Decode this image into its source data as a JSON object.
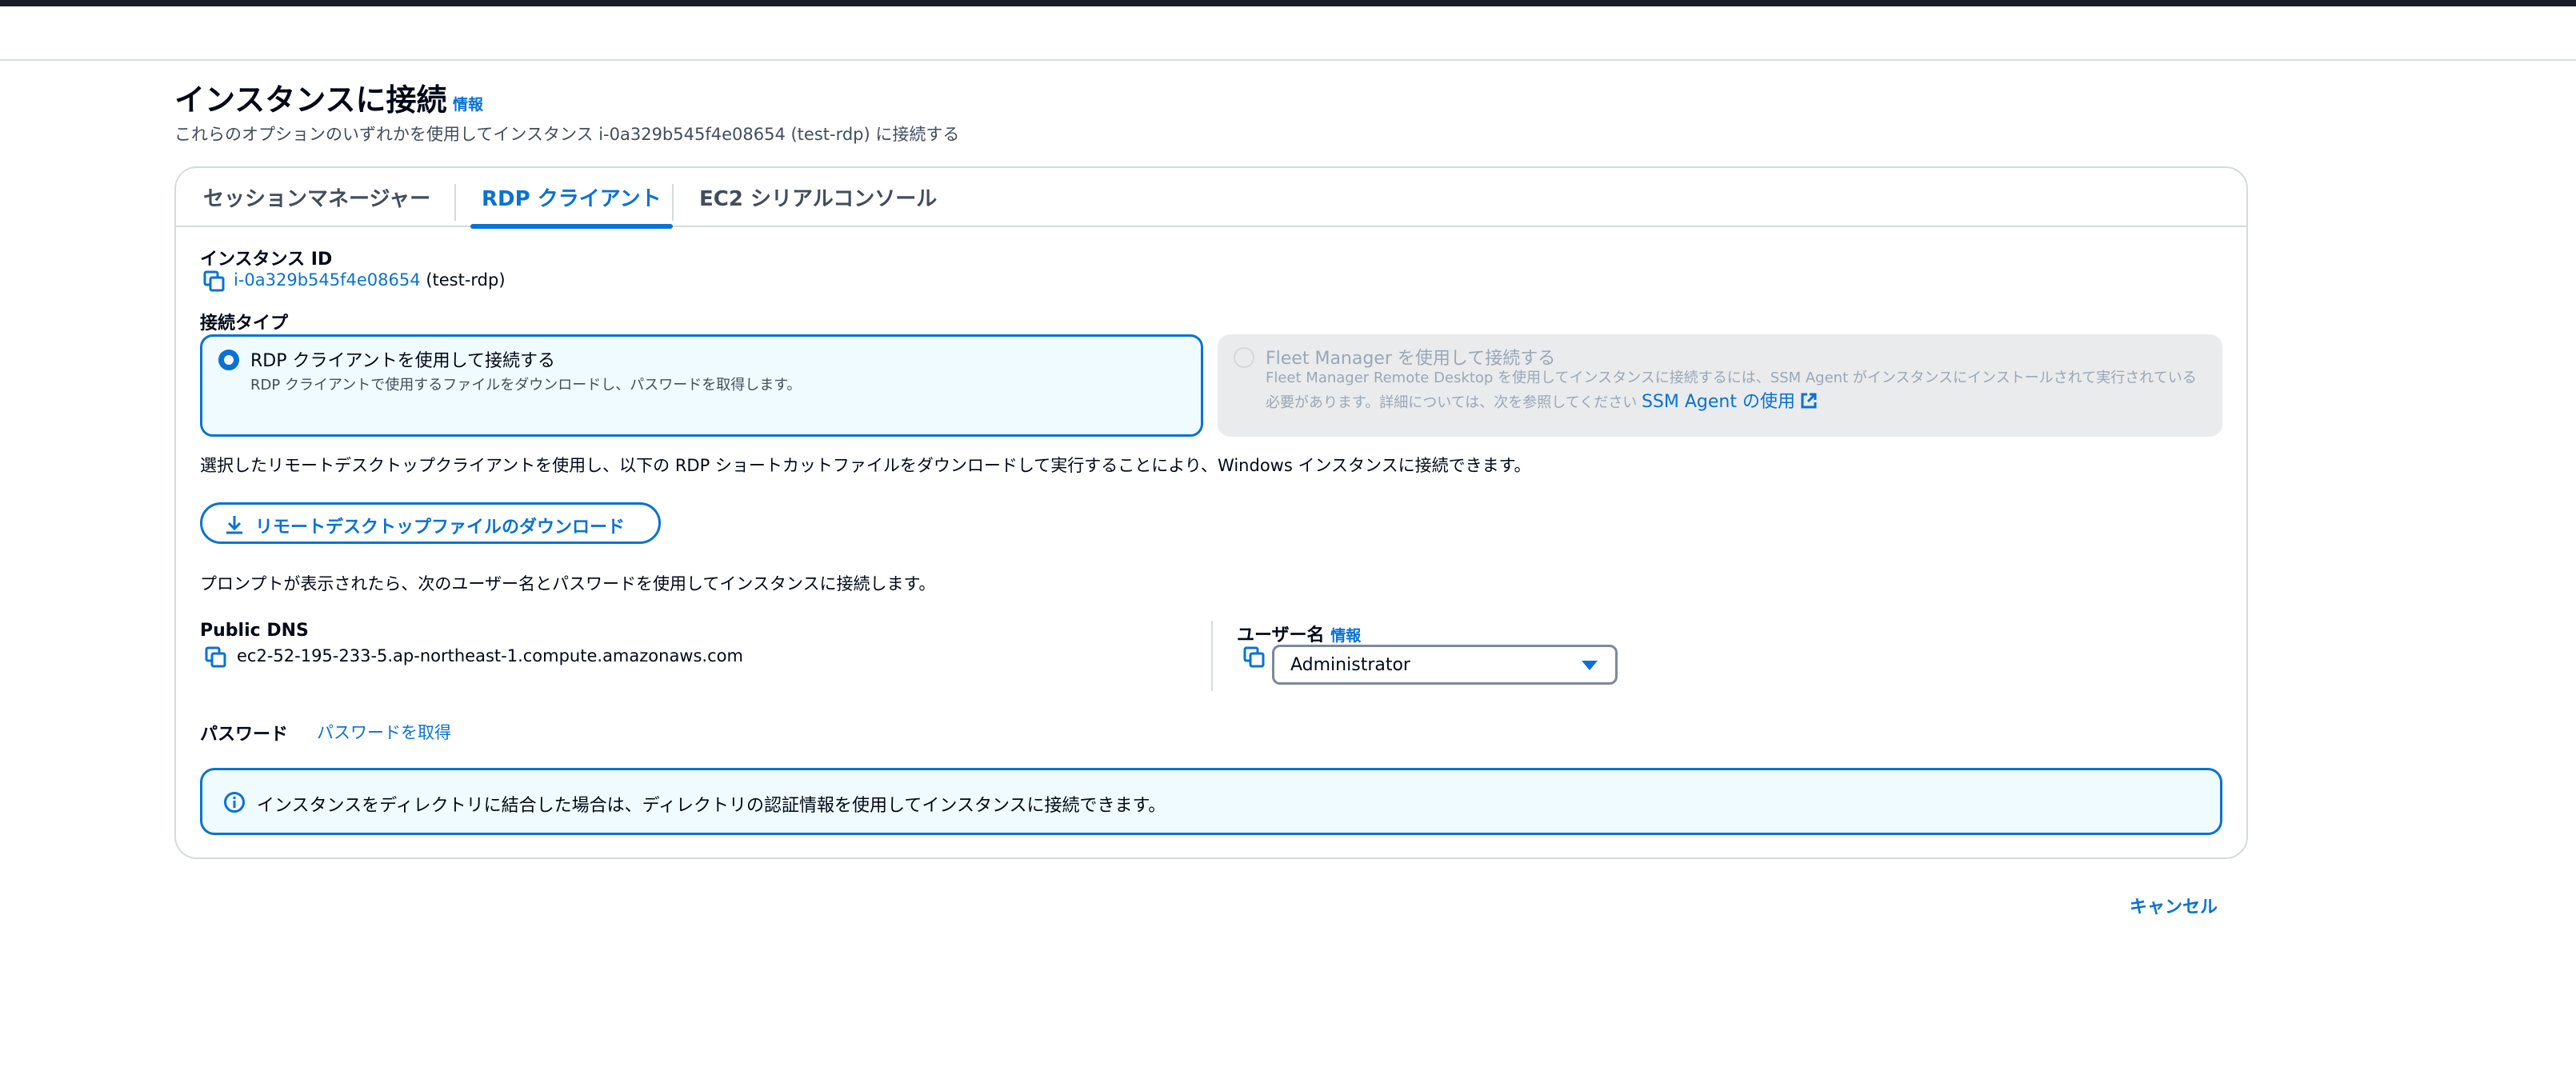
{
  "page": {
    "title": "インスタンスに接続",
    "title_info": "情報",
    "description": "これらのオプションのいずれかを使用してインスタンス i-0a329b545f4e08654 (test-rdp) に接続する"
  },
  "tabs": [
    {
      "label": "セッションマネージャー",
      "active": false
    },
    {
      "label": "RDP クライアント",
      "active": true
    },
    {
      "label": "EC2 シリアルコンソール",
      "active": false
    }
  ],
  "instance": {
    "label": "インスタンス ID",
    "id": "i-0a329b545f4e08654",
    "name": "(test-rdp)"
  },
  "connection_type": {
    "label": "接続タイプ",
    "options": [
      {
        "title": "RDP クライアントを使用して接続する",
        "description": "RDP クライアントで使用するファイルをダウンロードし、パスワードを取得します。",
        "selected": true,
        "disabled": false
      },
      {
        "title": "Fleet Manager を使用して接続する",
        "description": "Fleet Manager Remote Desktop を使用してインスタンスに接続するには、SSM Agent がインスタンスにインストールされて実行されている必要があります。詳細については、次を参照してください",
        "link": "SSM Agent の使用",
        "selected": false,
        "disabled": true
      }
    ]
  },
  "rdp_instructions": "選択したリモートデスクトップクライアントを使用し、以下の RDP ショートカットファイルをダウンロードして実行することにより、Windows インスタンスに接続できます。",
  "download_button": "リモートデスクトップファイルのダウンロード",
  "prompt_text": "プロンプトが表示されたら、次のユーザー名とパスワードを使用してインスタンスに接続します。",
  "public_dns": {
    "label": "Public DNS",
    "value": "ec2-52-195-233-5.ap-northeast-1.compute.amazonaws.com"
  },
  "username": {
    "label": "ユーザー名",
    "info": "情報",
    "selected": "Administrator"
  },
  "password": {
    "label": "パスワード",
    "link": "パスワードを取得"
  },
  "alert": {
    "text": "インスタンスをディレクトリに結合した場合は、ディレクトリの認証情報を使用してインスタンスに接続できます。"
  },
  "cancel_label": "キャンセル",
  "colors": {
    "accent": "#0972d3",
    "text": "#000716",
    "muted": "#414d5c",
    "disabled": "#9ba7b6",
    "border": "#d5dbdb",
    "info_bg": "#f0fbff"
  },
  "icons": [
    "copy-icon",
    "download-icon",
    "external-link-icon",
    "info-circle-icon",
    "caret-down-icon"
  ]
}
